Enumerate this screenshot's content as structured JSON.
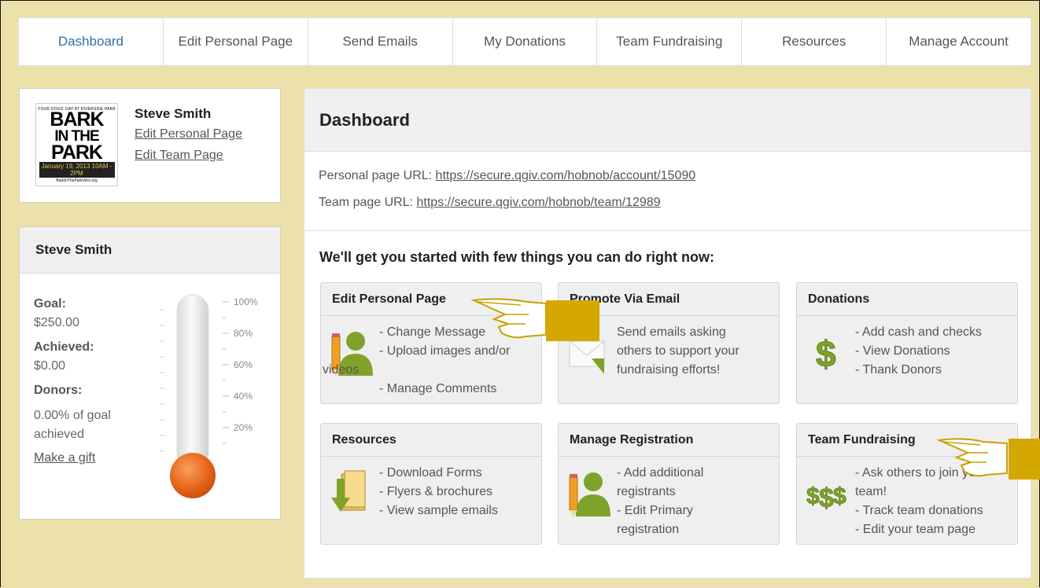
{
  "nav": {
    "tabs": [
      {
        "label": "Dashboard"
      },
      {
        "label": "Edit Personal Page"
      },
      {
        "label": "Send Emails"
      },
      {
        "label": "My Donations"
      },
      {
        "label": "Team Fundraising"
      },
      {
        "label": "Resources"
      },
      {
        "label": "Manage Account"
      }
    ]
  },
  "profile": {
    "logo": {
      "top": "YOUR DOGS' DAY AT RIVERSIDE PARK",
      "line1": "BARK",
      "line2": "IN THE",
      "line3": "PARK",
      "date": "January 19, 2013  10AM - 2PM",
      "url": "BarkInTheParkVero.org"
    },
    "name": "Steve Smith",
    "edit_personal": "Edit Personal Page",
    "edit_team": "Edit Team Page"
  },
  "stats": {
    "title": "Steve Smith",
    "goal_label": "Goal:",
    "goal_value": "$250.00",
    "achieved_label": "Achieved:",
    "achieved_value": "$0.00",
    "donors_label": "Donors:",
    "pct_line1": "0.00% of goal",
    "pct_line2": "achieved",
    "gift_link": "Make a gift",
    "thermo_fill": 0.0,
    "thermo_ticks": [
      "100%",
      "80%",
      "60%",
      "40%",
      "20%"
    ]
  },
  "main": {
    "title": "Dashboard",
    "personal_url_label": "Personal page URL:",
    "personal_url": "https://secure.qgiv.com/hobnob/account/15090",
    "team_url_label": "Team page URL:",
    "team_url": "https://secure.qgiv.com/hobnob/team/12989",
    "intro": "We'll get you started with few things you can do right now:",
    "cards": [
      {
        "title": "Edit Personal Page",
        "lines": [
          "- Change Message",
          "- Upload images and/or",
          "videos",
          "- Manage Comments"
        ],
        "icon": "person-edit-icon"
      },
      {
        "title": "Promote Via Email",
        "lines": [
          "Send emails asking",
          "others to support your",
          "fundraising efforts!"
        ],
        "icon": "email-icon"
      },
      {
        "title": "Donations",
        "lines": [
          "- Add cash and checks",
          "- View Donations",
          "- Thank Donors"
        ],
        "icon": "dollar-icon"
      },
      {
        "title": "Resources",
        "lines": [
          "- Download Forms",
          "- Flyers & brochures",
          "- View sample emails"
        ],
        "icon": "download-folder-icon"
      },
      {
        "title": "Manage Registration",
        "lines": [
          "- Add additional",
          "registrants",
          "- Edit Primary",
          "registration"
        ],
        "icon": "person-edit-icon"
      },
      {
        "title": "Team Fundraising",
        "lines": [
          "- Ask others to join your",
          "team!",
          "- Track team donations",
          "- Edit your team page"
        ],
        "icon": "multi-dollar-icon"
      }
    ]
  },
  "colors": {
    "background": "#ece1ab",
    "active_tab": "#2f6fa7",
    "thermo_bulb": "#e8661c",
    "hand": "#d4a800"
  }
}
